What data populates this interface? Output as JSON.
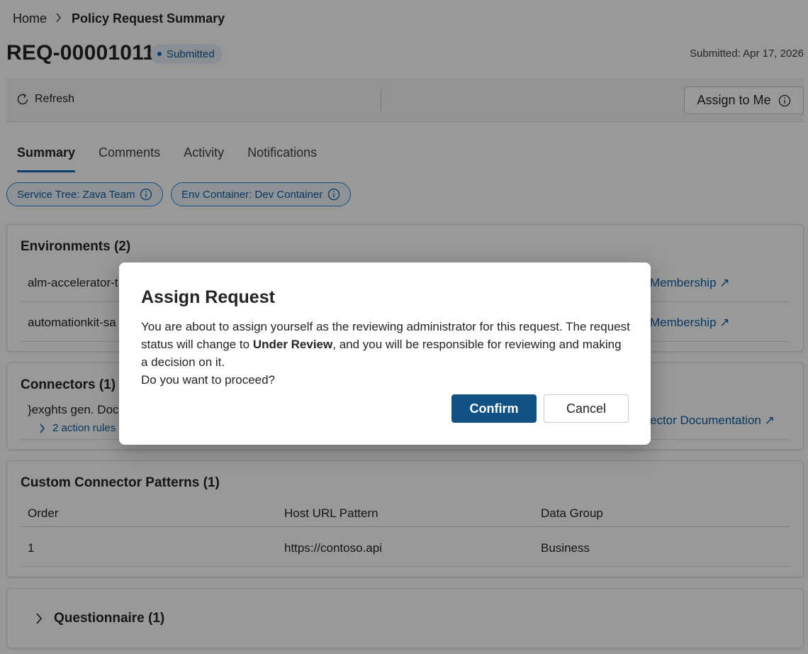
{
  "breadcrumb": {
    "home": "Home",
    "current": "Policy Request Summary"
  },
  "request": {
    "id": "REQ-00001011",
    "status": "Submitted",
    "submitted": "Submitted: Apr 17, 2026"
  },
  "toolbar": {
    "refresh_label": "Refresh",
    "assign_label": "Assign to Me"
  },
  "tabs": [
    {
      "label": "Summary",
      "active": true
    },
    {
      "label": "Comments"
    },
    {
      "label": "Activity"
    },
    {
      "label": "Notifications"
    }
  ],
  "chips": [
    {
      "label": "Service Tree: Zava Team"
    },
    {
      "label": "Env Container: Dev Container"
    }
  ],
  "environments": {
    "title": "Environments (2)",
    "rows": [
      {
        "name": "alm-accelerator-t",
        "link": "Membership ↗"
      },
      {
        "name": "automationkit-sa",
        "link": "Membership ↗"
      }
    ]
  },
  "connectors": {
    "title": "Connectors (1)",
    "rows": [
      {
        "name": "}exghts gen. Doc",
        "rules": "2 action rules",
        "link": "ector Documentation ↗"
      }
    ]
  },
  "custom_connector_patterns": {
    "title": "Custom Connector Patterns (1)",
    "headers": [
      "Order",
      "Host URL Pattern",
      "Data Group"
    ],
    "rows": [
      [
        "1",
        "https://contoso.api",
        "Business"
      ]
    ]
  },
  "questionnaire": {
    "title": "Questionnaire (1)"
  },
  "dialog": {
    "title": "Assign Request",
    "body_part1": "You are about to assign yourself as the reviewing administrator for this request. The request status will change to ",
    "body_bold": "Under Review",
    "body_part2": ", and you will be responsible for reviewing and making a decision on it.",
    "question": "Do you want to proceed?",
    "confirm_label": "Confirm",
    "cancel_label": "Cancel"
  },
  "colors": {
    "accent": "#0f6cbd",
    "primary_button": "#0f5283",
    "link": "#115ea3"
  }
}
